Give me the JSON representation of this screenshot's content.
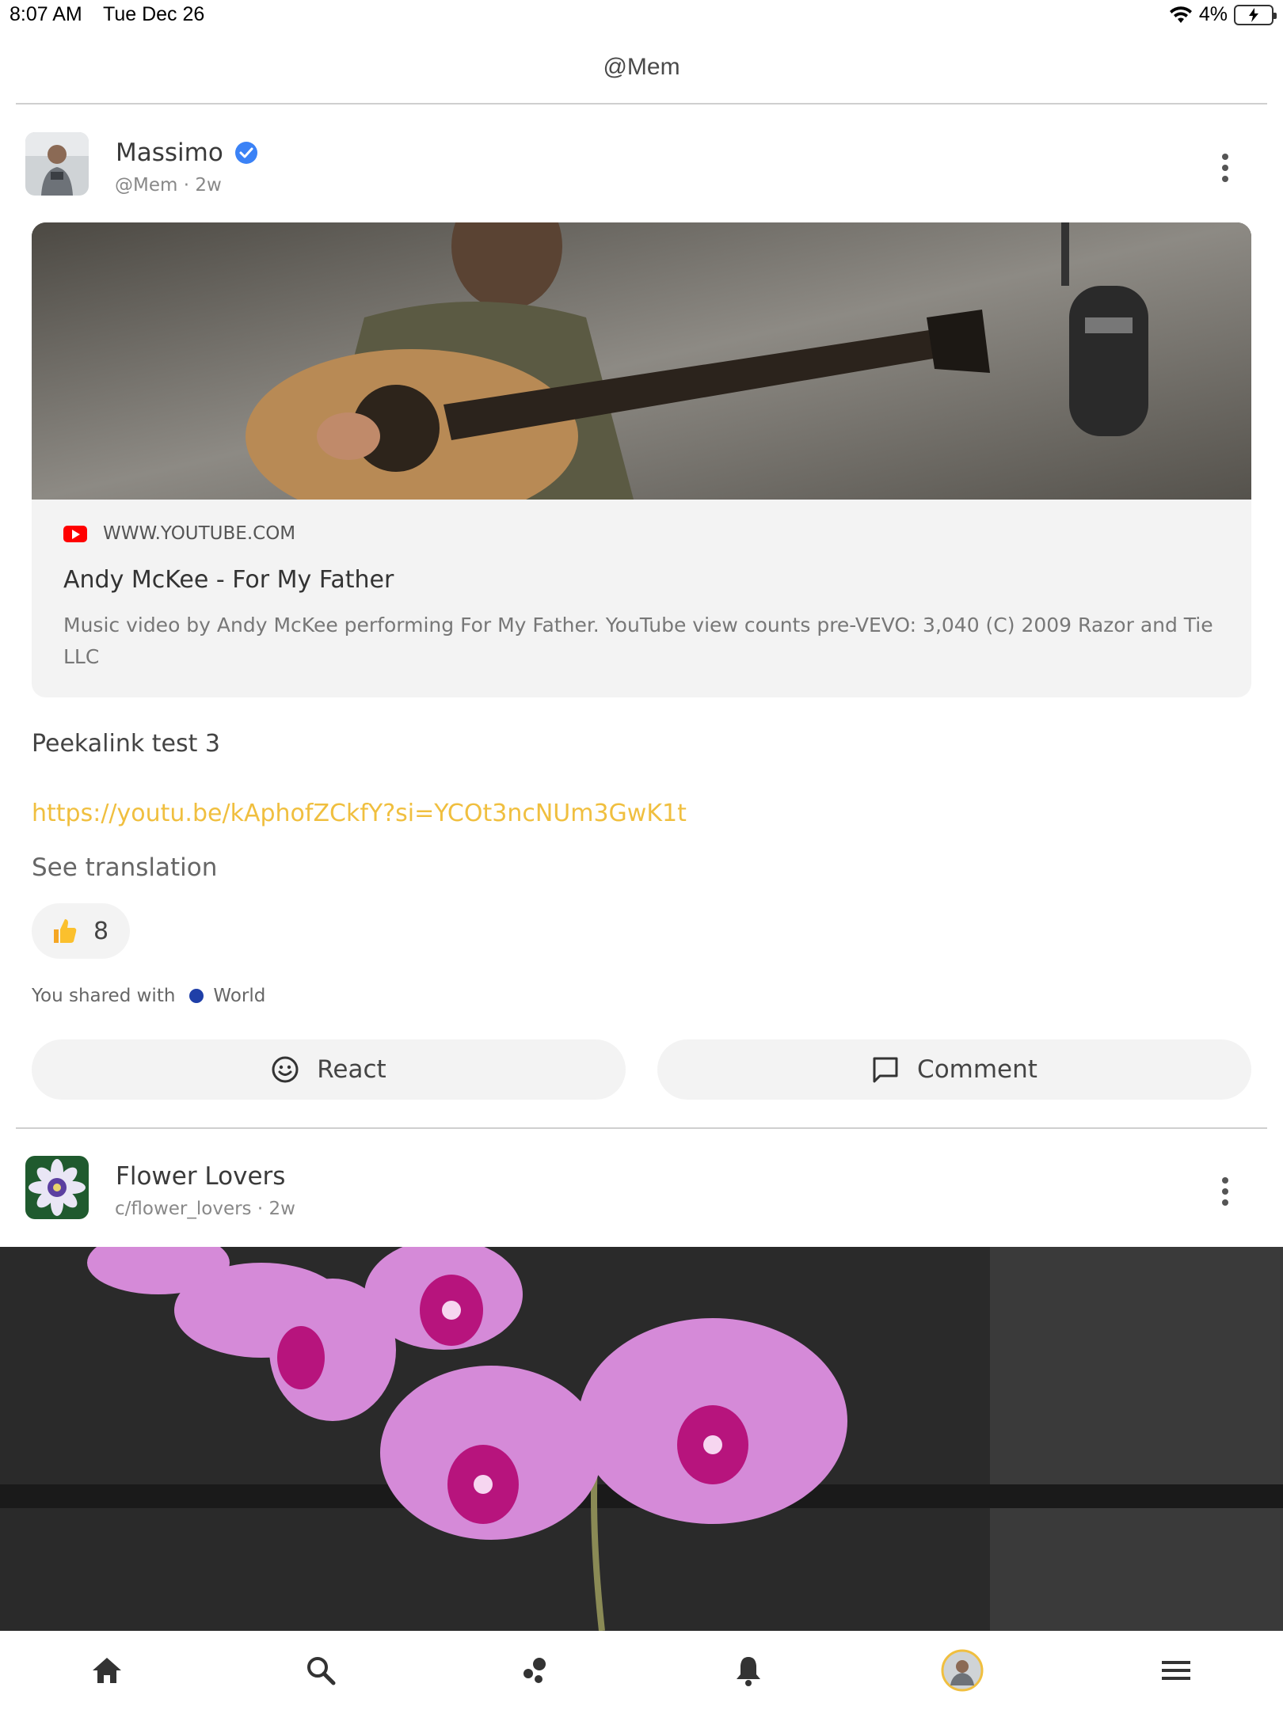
{
  "status_bar": {
    "time": "8:07 AM",
    "date": "Tue Dec 26",
    "battery": "4%"
  },
  "header": {
    "title": "@Mem"
  },
  "posts": [
    {
      "author": "Massimo",
      "verified": true,
      "meta": "@Mem · 2w",
      "link_preview": {
        "source": "WWW.YOUTUBE.COM",
        "title": "Andy McKee - For My Father",
        "description": "Music video by Andy McKee performing For My Father. YouTube view counts pre-VEVO: 3,040 (C) 2009 Razor and Tie LLC"
      },
      "text": "Peekalink test 3",
      "link": "https://youtu.be/kAphofZCkfY?si=YCOt3ncNUm3GwK1t",
      "translation_label": "See translation",
      "reaction_count": "8",
      "shared_label": "You shared with",
      "audience": "World",
      "actions": {
        "react": "React",
        "comment": "Comment"
      }
    },
    {
      "author": "Flower Lovers",
      "meta": "c/flower_lovers · 2w"
    }
  ],
  "tab_bar": {
    "tabs": [
      "home-icon",
      "search-icon",
      "communities-icon",
      "bell-icon",
      "profile-avatar",
      "menu-icon"
    ]
  },
  "colors": {
    "link": "#f0bf3f",
    "verified": "#3b82f6",
    "world_dot": "#1f3fa8",
    "youtube": "#ff0000"
  }
}
